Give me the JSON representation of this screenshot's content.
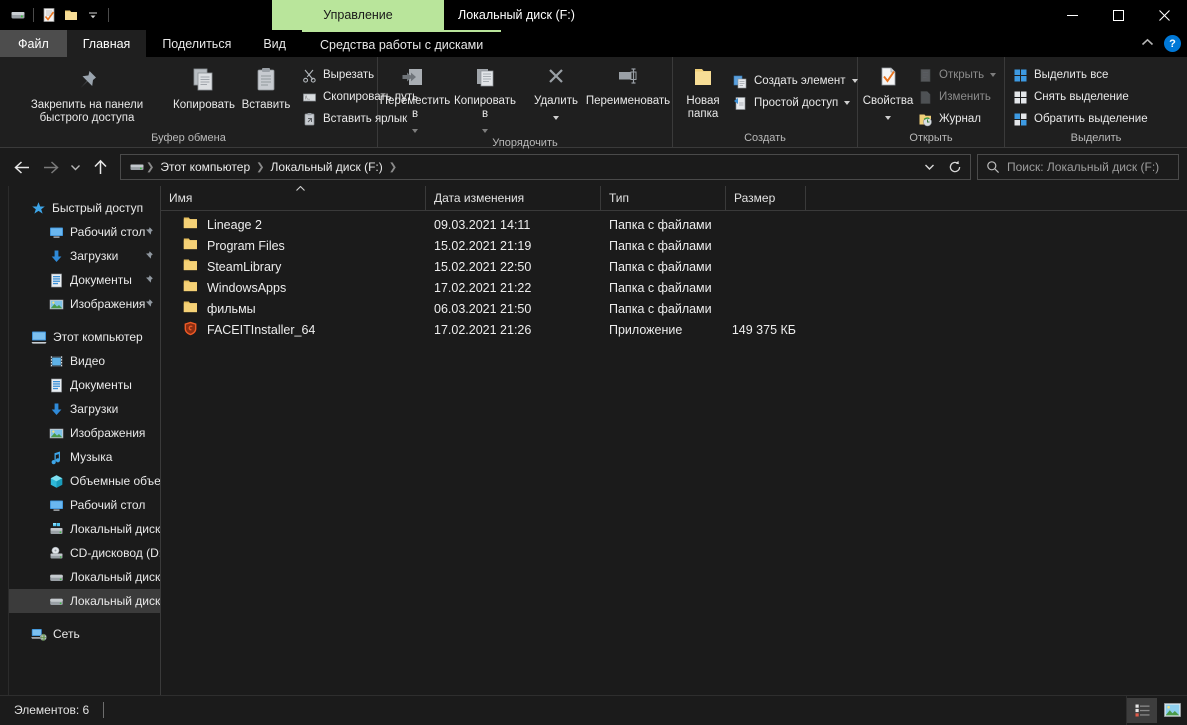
{
  "window": {
    "title": "Локальный диск (F:)",
    "contextual_tab": "Управление",
    "minimize": "–",
    "maximize": "□",
    "close": "✕"
  },
  "quick_access_toolbar": {
    "items": [
      {
        "name": "drive-icon"
      },
      {
        "name": "properties-icon"
      },
      {
        "name": "new-folder-icon"
      },
      {
        "name": "customize-dropdown-icon"
      }
    ]
  },
  "tabs": [
    {
      "id": "file",
      "label": "Файл"
    },
    {
      "id": "home",
      "label": "Главная"
    },
    {
      "id": "share",
      "label": "Поделиться"
    },
    {
      "id": "view",
      "label": "Вид"
    },
    {
      "id": "drive-tools",
      "label": "Средства работы с дисками"
    }
  ],
  "ribbon_controls": {
    "collapse": "⌃",
    "help": "?"
  },
  "ribbon": {
    "groups": [
      {
        "id": "clipboard",
        "label": "Буфер обмена",
        "big_buttons": [
          {
            "id": "pin-to-quick-access",
            "label": "Закрепить на панели\nбыстрого доступа",
            "icon": "pin-icon"
          },
          {
            "id": "copy",
            "label": "Копировать",
            "icon": "copy-icon"
          },
          {
            "id": "paste",
            "label": "Вставить",
            "icon": "paste-icon"
          }
        ],
        "small_buttons": [
          {
            "id": "cut",
            "label": "Вырезать",
            "icon": "scissors-icon"
          },
          {
            "id": "copy-path",
            "label": "Скопировать путь",
            "icon": "copy-path-icon"
          },
          {
            "id": "paste-shortcut",
            "label": "Вставить ярлык",
            "icon": "paste-shortcut-icon"
          }
        ]
      },
      {
        "id": "organize",
        "label": "Упорядочить",
        "big_buttons": [
          {
            "id": "move-to",
            "label": "Переместить\nв",
            "icon": "move-to-icon",
            "dropdown": true
          },
          {
            "id": "copy-to",
            "label": "Копировать\nв",
            "icon": "copy-to-icon",
            "dropdown": true
          },
          {
            "id": "delete",
            "label": "Удалить",
            "icon": "delete-icon",
            "dropdown": true
          },
          {
            "id": "rename",
            "label": "Переименовать",
            "icon": "rename-icon"
          }
        ],
        "small_buttons": []
      },
      {
        "id": "new",
        "label": "Создать",
        "big_buttons": [
          {
            "id": "new-folder",
            "label": "Новая\nпапка",
            "icon": "new-folder-icon"
          }
        ],
        "small_buttons": [
          {
            "id": "new-item",
            "label": "Создать элемент",
            "icon": "new-item-icon",
            "dropdown": true
          },
          {
            "id": "easy-access",
            "label": "Простой доступ",
            "icon": "easy-access-icon",
            "dropdown": true
          }
        ]
      },
      {
        "id": "open",
        "label": "Открыть",
        "big_buttons": [
          {
            "id": "properties",
            "label": "Свойства",
            "icon": "properties-icon",
            "dropdown": true
          }
        ],
        "small_buttons": [
          {
            "id": "open",
            "label": "Открыть",
            "icon": "open-icon",
            "dropdown": true,
            "dim": true
          },
          {
            "id": "edit",
            "label": "Изменить",
            "icon": "edit-icon",
            "dim": true
          },
          {
            "id": "history",
            "label": "Журнал",
            "icon": "history-icon"
          }
        ]
      },
      {
        "id": "select",
        "label": "Выделить",
        "big_buttons": [],
        "small_buttons": [
          {
            "id": "select-all",
            "label": "Выделить все",
            "icon": "select-all-icon"
          },
          {
            "id": "select-none",
            "label": "Снять выделение",
            "icon": "select-none-icon"
          },
          {
            "id": "invert-selection",
            "label": "Обратить выделение",
            "icon": "invert-selection-icon"
          }
        ]
      }
    ]
  },
  "addressbar": {
    "back": "←",
    "forward": "→",
    "recent": "⌄",
    "up": "↑",
    "crumbs": [
      {
        "id": "this-pc",
        "label": "Этот компьютер"
      },
      {
        "id": "local-disk-f",
        "label": "Локальный диск (F:)"
      }
    ],
    "dropdown": "⌄",
    "refresh": "↻"
  },
  "search": {
    "placeholder": "Поиск: Локальный диск (F:)",
    "icon": "search-icon"
  },
  "sidebar": {
    "items": [
      {
        "id": "quick-access",
        "label": "Быстрый доступ",
        "level": "root",
        "icon": "star-icon"
      },
      {
        "id": "qa-desktop",
        "label": "Рабочий стол",
        "level": "child",
        "icon": "desktop-icon",
        "pinned": true
      },
      {
        "id": "qa-downloads",
        "label": "Загрузки",
        "level": "child",
        "icon": "downloads-icon",
        "pinned": true
      },
      {
        "id": "qa-documents",
        "label": "Документы",
        "level": "child",
        "icon": "documents-icon",
        "pinned": true
      },
      {
        "id": "qa-pictures",
        "label": "Изображения",
        "level": "child",
        "icon": "pictures-icon",
        "pinned": true
      },
      {
        "id": "this-pc",
        "label": "Этот компьютер",
        "level": "root",
        "icon": "computer-icon",
        "gap_before": true
      },
      {
        "id": "pc-videos",
        "label": "Видео",
        "level": "child",
        "icon": "videos-icon"
      },
      {
        "id": "pc-documents",
        "label": "Документы",
        "level": "child",
        "icon": "documents-icon"
      },
      {
        "id": "pc-downloads",
        "label": "Загрузки",
        "level": "child",
        "icon": "downloads-icon"
      },
      {
        "id": "pc-pictures",
        "label": "Изображения",
        "level": "child",
        "icon": "pictures-icon"
      },
      {
        "id": "pc-music",
        "label": "Музыка",
        "level": "child",
        "icon": "music-icon"
      },
      {
        "id": "pc-3d-objects",
        "label": "Объемные объекты",
        "level": "child",
        "icon": "3d-objects-icon"
      },
      {
        "id": "pc-desktop",
        "label": "Рабочий стол",
        "level": "child",
        "icon": "desktop-icon"
      },
      {
        "id": "disk-c",
        "label": "Локальный диск (C:)",
        "level": "child",
        "icon": "windows-drive-icon"
      },
      {
        "id": "cd-drive-d",
        "label": "CD-дисковод (D:)",
        "level": "child",
        "icon": "cd-drive-icon"
      },
      {
        "id": "disk-e",
        "label": "Локальный диск (E:)",
        "level": "child",
        "icon": "drive-icon"
      },
      {
        "id": "disk-f",
        "label": "Локальный диск (F:)",
        "level": "child",
        "icon": "drive-icon",
        "selected": true
      },
      {
        "id": "network",
        "label": "Сеть",
        "level": "root",
        "icon": "network-icon",
        "gap_before": true
      }
    ]
  },
  "filelist": {
    "columns": [
      {
        "id": "name",
        "label": "Имя",
        "sorted": "asc"
      },
      {
        "id": "date",
        "label": "Дата изменения"
      },
      {
        "id": "type",
        "label": "Тип"
      },
      {
        "id": "size",
        "label": "Размер"
      }
    ],
    "sort_indicator": "⌃",
    "rows": [
      {
        "icon": "folder-icon",
        "name": "Lineage 2",
        "date": "09.03.2021 14:11",
        "type": "Папка с файлами",
        "size": ""
      },
      {
        "icon": "folder-icon",
        "name": "Program Files",
        "date": "15.02.2021 21:19",
        "type": "Папка с файлами",
        "size": ""
      },
      {
        "icon": "folder-icon",
        "name": "SteamLibrary",
        "date": "15.02.2021 22:50",
        "type": "Папка с файлами",
        "size": ""
      },
      {
        "icon": "folder-icon",
        "name": "WindowsApps",
        "date": "17.02.2021 21:22",
        "type": "Папка с файлами",
        "size": ""
      },
      {
        "icon": "folder-icon",
        "name": "фильмы",
        "date": "06.03.2021 21:50",
        "type": "Папка с файлами",
        "size": ""
      },
      {
        "icon": "faceit-shield-icon",
        "name": "FACEITInstaller_64",
        "date": "17.02.2021 21:26",
        "type": "Приложение",
        "size": "149 375 КБ"
      }
    ]
  },
  "statusbar": {
    "item_count": "Элементов: 6",
    "views": [
      {
        "id": "details-view",
        "icon": "details-view-icon",
        "active": true
      },
      {
        "id": "large-icons-view",
        "icon": "large-icons-view-icon",
        "active": false
      }
    ]
  },
  "colors": {
    "window_bg": "#1b1b1b",
    "ribbon_bg": "#1f1f1f",
    "titlebar_bg": "#000000",
    "contextual_tab": "#b9e59b",
    "accent_blue": "#0078d7",
    "folder_yellow": "#f5cf6b",
    "faceit_orange": "#ef5a26",
    "selection_bg": "#3b3b3b"
  }
}
